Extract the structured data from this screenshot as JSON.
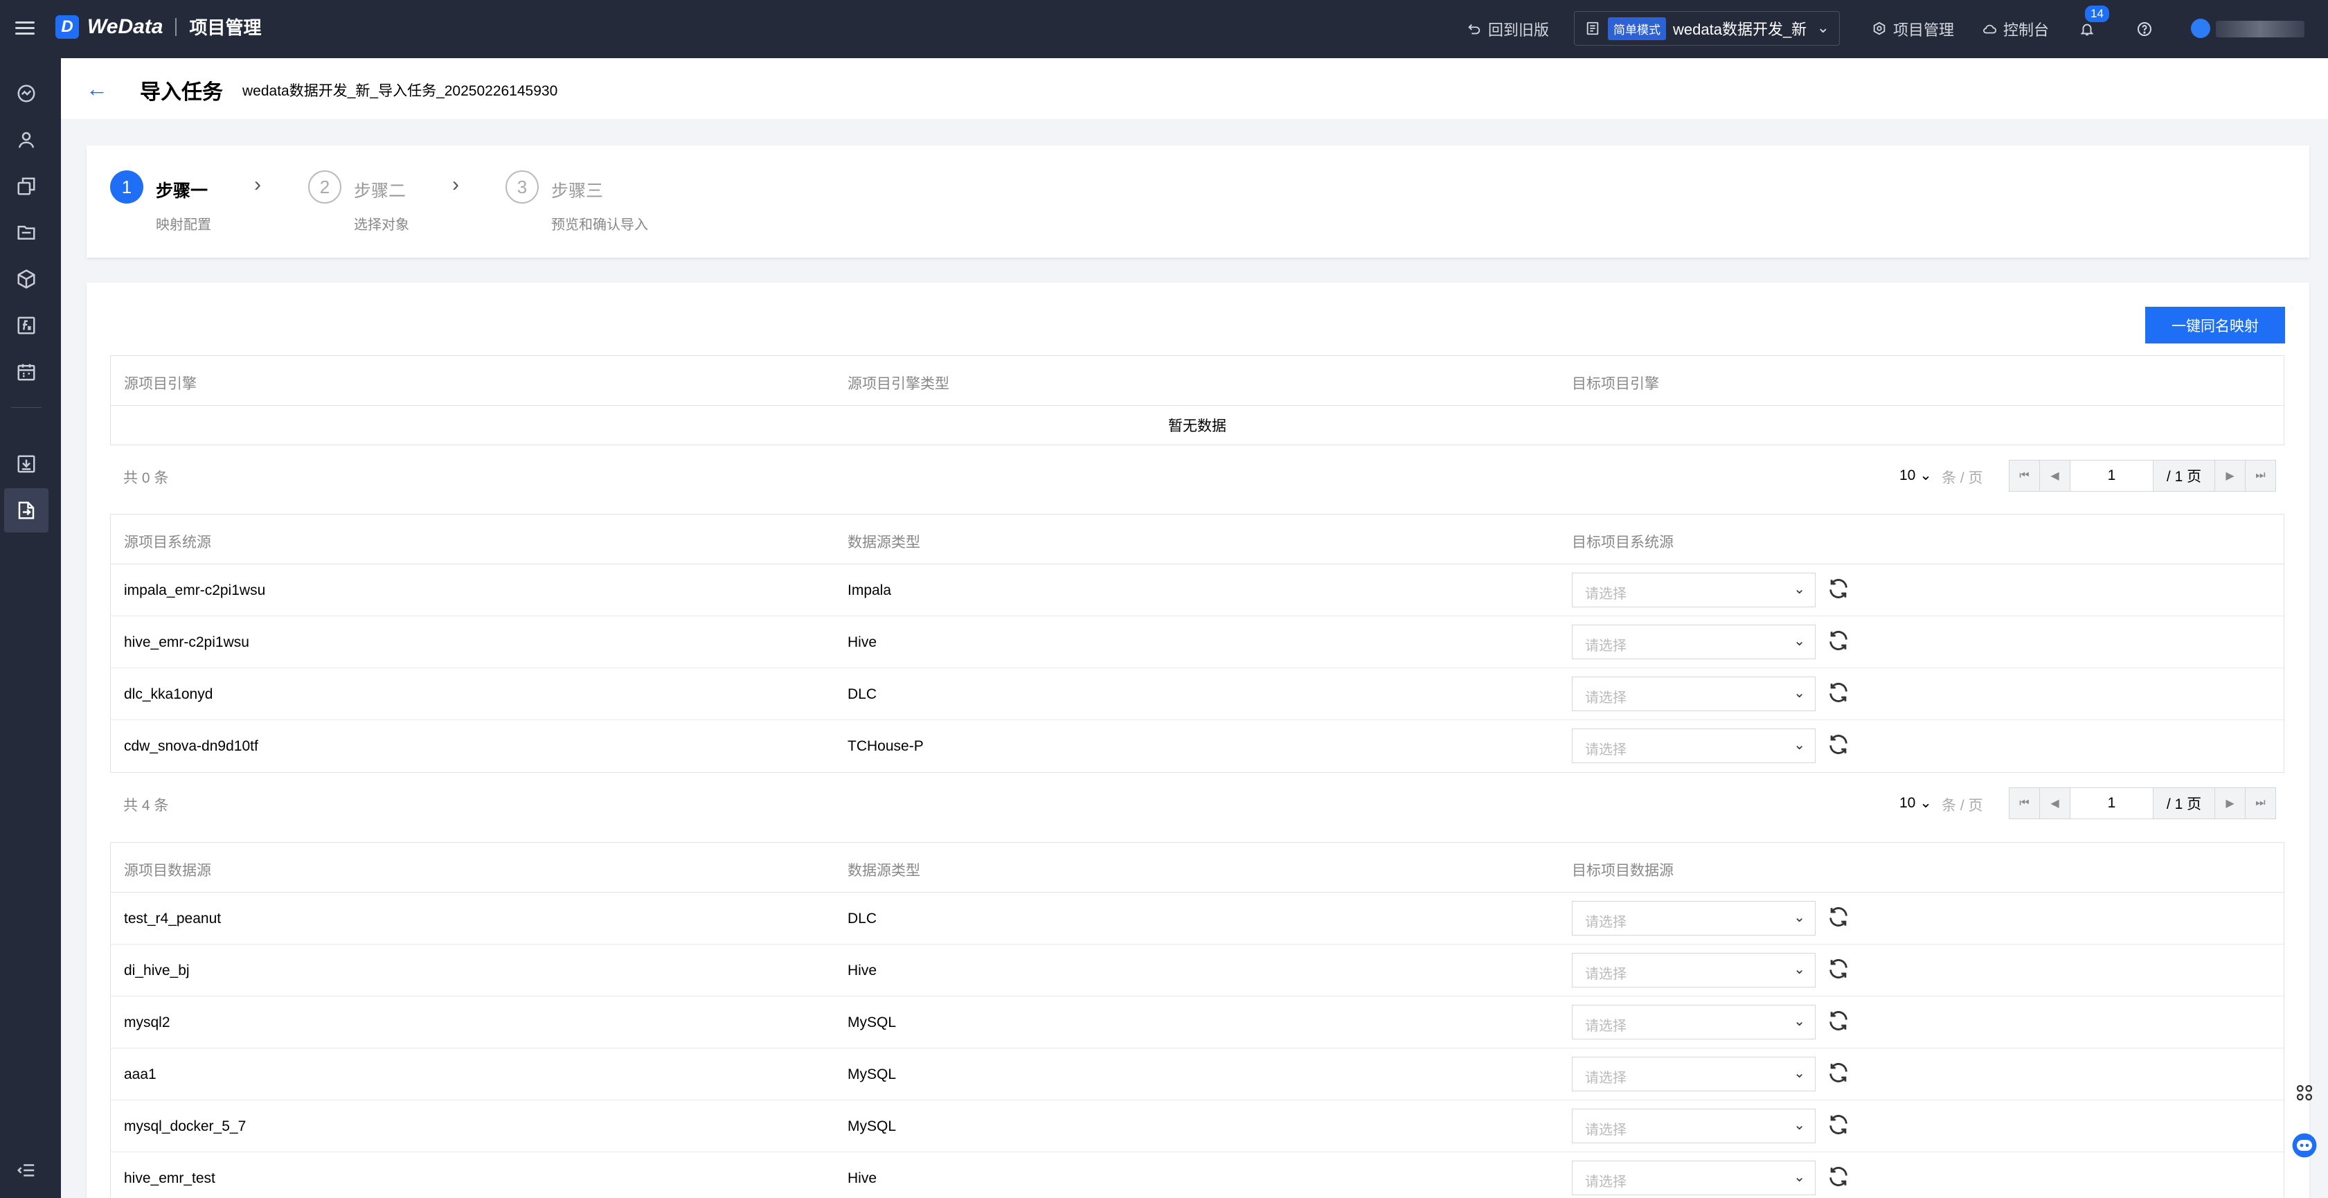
{
  "topbar": {
    "brand": "WeData",
    "brand_mark": "D",
    "section": "项目管理",
    "back_old": "回到旧版",
    "mode_badge": "简单模式",
    "project_name": "wedata数据开发_新",
    "project_mgmt": "项目管理",
    "console": "控制台",
    "notification_count": "14"
  },
  "title": {
    "heading": "导入任务",
    "task_name": "wedata数据开发_新_导入任务_20250226145930"
  },
  "steps": [
    {
      "num": "1",
      "title": "步骤一",
      "desc": "映射配置"
    },
    {
      "num": "2",
      "title": "步骤二",
      "desc": "选择对象"
    },
    {
      "num": "3",
      "title": "步骤三",
      "desc": "预览和确认导入"
    }
  ],
  "map_button": "一键同名映射",
  "engine_table": {
    "headers": [
      "源项目引擎",
      "源项目引擎类型",
      "目标项目引擎"
    ],
    "empty": "暂无数据",
    "total": "共 0 条"
  },
  "system_table": {
    "headers": [
      "源项目系统源",
      "数据源类型",
      "目标项目系统源"
    ],
    "rows": [
      {
        "name": "impala_emr-c2pi1wsu",
        "type": "Impala"
      },
      {
        "name": "hive_emr-c2pi1wsu",
        "type": "Hive"
      },
      {
        "name": "dlc_kka1onyd",
        "type": "DLC"
      },
      {
        "name": "cdw_snova-dn9d10tf",
        "type": "TCHouse-P"
      }
    ],
    "total": "共 4 条"
  },
  "datasource_table": {
    "headers": [
      "源项目数据源",
      "数据源类型",
      "目标项目数据源"
    ],
    "rows": [
      {
        "name": "test_r4_peanut",
        "type": "DLC"
      },
      {
        "name": "di_hive_bj",
        "type": "Hive"
      },
      {
        "name": "mysql2",
        "type": "MySQL"
      },
      {
        "name": "aaa1",
        "type": "MySQL"
      },
      {
        "name": "mysql_docker_5_7",
        "type": "MySQL"
      },
      {
        "name": "hive_emr_test",
        "type": "Hive"
      }
    ]
  },
  "select_placeholder": "请选择",
  "pagination": {
    "page_size": "10",
    "page_size_unit": "条 / 页",
    "current_page": "1",
    "total_pages": "/ 1 页"
  }
}
